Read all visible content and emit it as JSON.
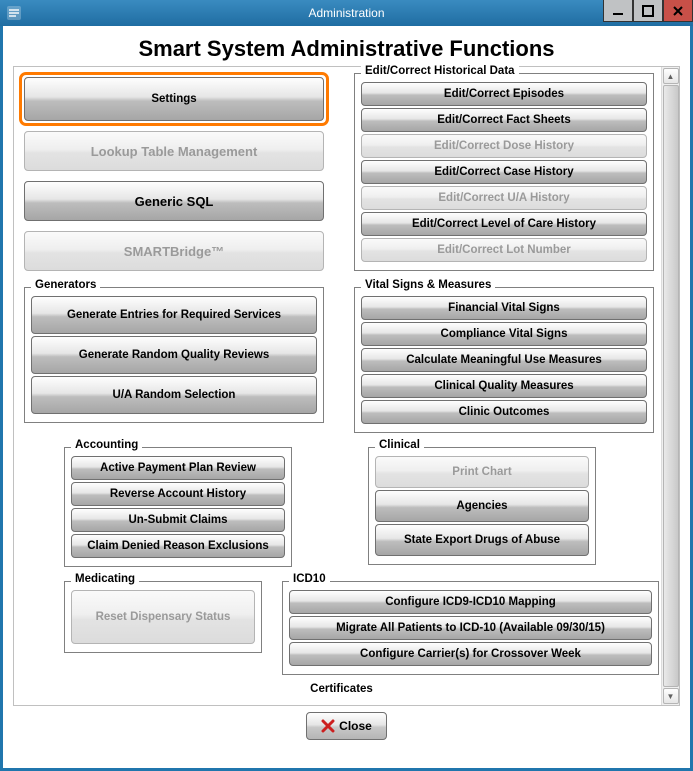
{
  "window": {
    "title": "Administration"
  },
  "page": {
    "title": "Smart System Administrative Functions"
  },
  "left_main": {
    "settings": "Settings",
    "lookup": "Lookup Table Management",
    "generic_sql": "Generic SQL",
    "smartbridge": "SMARTBridge™"
  },
  "historical": {
    "legend": "Edit/Correct Historical Data",
    "episodes": "Edit/Correct Episodes",
    "fact_sheets": "Edit/Correct Fact Sheets",
    "dose_history": "Edit/Correct Dose History",
    "case_history": "Edit/Correct Case History",
    "ua_history": "Edit/Correct U/A History",
    "level_of_care": "Edit/Correct Level of Care History",
    "lot_number": "Edit/Correct Lot Number"
  },
  "generators": {
    "legend": "Generators",
    "required_services": "Generate Entries for Required Services",
    "random_quality": "Generate Random Quality Reviews",
    "ua_random": "U/A Random Selection"
  },
  "vitals": {
    "legend": "Vital Signs & Measures",
    "financial": "Financial Vital Signs",
    "compliance": "Compliance Vital Signs",
    "meaningful_use": "Calculate Meaningful Use Measures",
    "clinical_quality": "Clinical Quality Measures",
    "clinic_outcomes": "Clinic Outcomes"
  },
  "accounting": {
    "legend": "Accounting",
    "payment_plan": "Active Payment Plan Review",
    "reverse": "Reverse Account History",
    "unsubmit": "Un-Submit Claims",
    "denied": "Claim Denied Reason Exclusions"
  },
  "clinical": {
    "legend": "Clinical",
    "print_chart": "Print Chart",
    "agencies": "Agencies",
    "state_export": "State Export Drugs of Abuse"
  },
  "medicating": {
    "legend": "Medicating",
    "reset_dispensary": "Reset Dispensary Status"
  },
  "icd10": {
    "legend": "ICD10",
    "configure_mapping": "Configure ICD9-ICD10 Mapping",
    "migrate": "Migrate All Patients to ICD-10 (Available 09/30/15)",
    "configure_carrier": "Configure Carrier(s) for Crossover Week"
  },
  "certificates": {
    "legend": "Certificates"
  },
  "footer": {
    "close": "Close"
  }
}
